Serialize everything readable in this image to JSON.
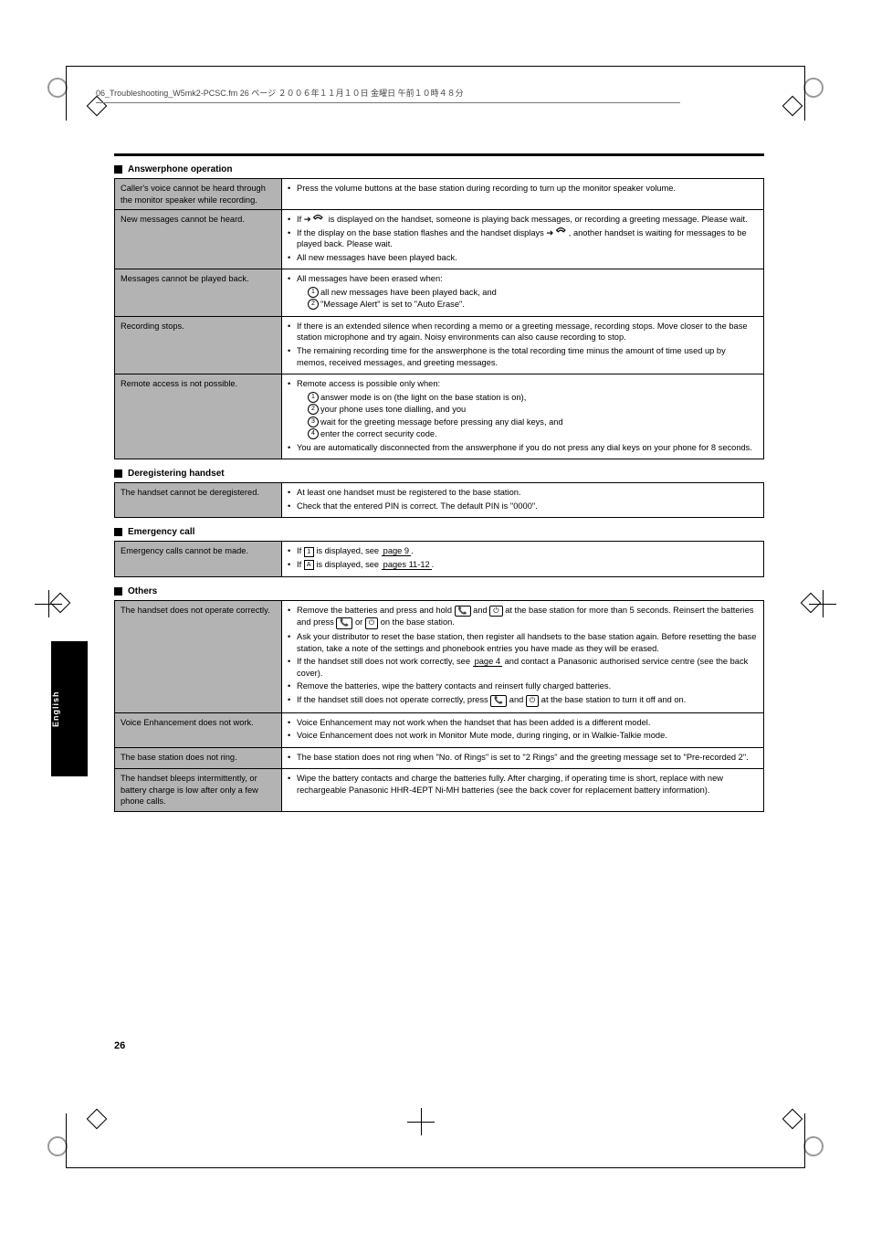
{
  "header_line": "06_Troubleshooting_W5mk2-PCSC.fm  26 ページ  ２００６年１１月１０日 金曜日 午前１０時４８分",
  "page_number": "26",
  "side_tab": "English",
  "sections": [
    {
      "title": "Answerphone operation",
      "rows": [
        {
          "label": "Caller's voice cannot be heard through the monitor speaker while recording.",
          "items": [
            "Press the volume buttons at the base station during recording to turn up the monitor speaker volume."
          ]
        },
        {
          "label": "New messages cannot be heard.",
          "items": [
            "If ➔ [hand] is displayed on the handset, someone is playing back messages, or recording a greeting message. Please wait.",
            "If the display on the base station flashes and the handset displays ➔ [hand], another handset is waiting for messages to be played back. Please wait.",
            "All new messages have been played back."
          ]
        },
        {
          "label": "Messages cannot be played back.",
          "items": [
            "All messages have been erased when:",
            "[num1] all new messages have been played back, and",
            "[num2] \"Message Alert\" is set to \"Auto Erase\"."
          ]
        },
        {
          "label": "Recording stops.",
          "items": [
            "If there is an extended silence when recording a memo or a greeting message, recording stops. Move closer to the base station microphone and try again. Noisy environments can also cause recording to stop.",
            "The remaining recording time for the answerphone is the total recording time minus the amount of time used up by memos, received messages, and greeting messages."
          ]
        },
        {
          "label": "Remote access is not possible.",
          "items": [
            "Remote access is possible only when:",
            "[num1] answer mode is on (the light on the base station is on),",
            "[num2] your phone uses tone dialling, and you",
            "[num3] wait for the greeting message before pressing any dial keys, and",
            "[num4] enter the correct security code.",
            "You are automatically disconnected from the answerphone if you do not press any dial keys on your phone for 8 seconds."
          ]
        }
      ]
    },
    {
      "title": "Deregistering handset",
      "rows": [
        {
          "label": "The handset cannot be deregistered.",
          "items": [
            "At least one handset must be registered to the base station.",
            "Check that the entered PIN is correct. The default PIN is \"0000\"."
          ]
        }
      ]
    },
    {
      "title": "Emergency call",
      "rows": [
        {
          "label": "Emergency calls cannot be made.",
          "items": [
            "If [1] is displayed, see [ref:page 9].",
            "If [A] is displayed, see [ref:pages 11-12]."
          ]
        }
      ]
    },
    {
      "title": "Others",
      "rows": [
        {
          "label": "The handset does not operate correctly.",
          "items": [
            "Remove the batteries and press and hold [talk] and [off] at the base station for more than 5 seconds. Reinsert the batteries and press [talk] or [off] on the base station.",
            "Ask your distributor to reset the base station, then register all handsets to the base station again. Before resetting the base station, take a note of the settings and phonebook entries you have made as they will be erased.",
            "If the handset still does not work correctly, see [ref:page 4] and contact a Panasonic authorised service centre (see the back cover).",
            "Remove the batteries, wipe the battery contacts and reinsert fully charged batteries.",
            "If the handset still does not operate correctly, press [talk] and [off] at the base station to turn it off and on."
          ]
        },
        {
          "label": "Voice Enhancement does not work.",
          "items": [
            "Voice Enhancement may not work when the handset that has been added is a different model.",
            "Voice Enhancement does not work in Monitor Mute mode, during ringing, or in Walkie-Talkie mode."
          ]
        },
        {
          "label": "The base station does not ring.",
          "items": [
            "The base station does not ring when \"No. of Rings\" is set to \"2 Rings\" and the greeting message set to \"Pre-recorded 2\"."
          ]
        },
        {
          "label": "The handset bleeps intermittently, or battery charge is low after only a few phone calls.",
          "items": [
            "Wipe the battery contacts and charge the batteries fully. After charging, if operating time is short, replace with new rechargeable Panasonic HHR-4EPT Ni-MH batteries (see the back cover for replacement battery information)."
          ]
        }
      ]
    }
  ]
}
